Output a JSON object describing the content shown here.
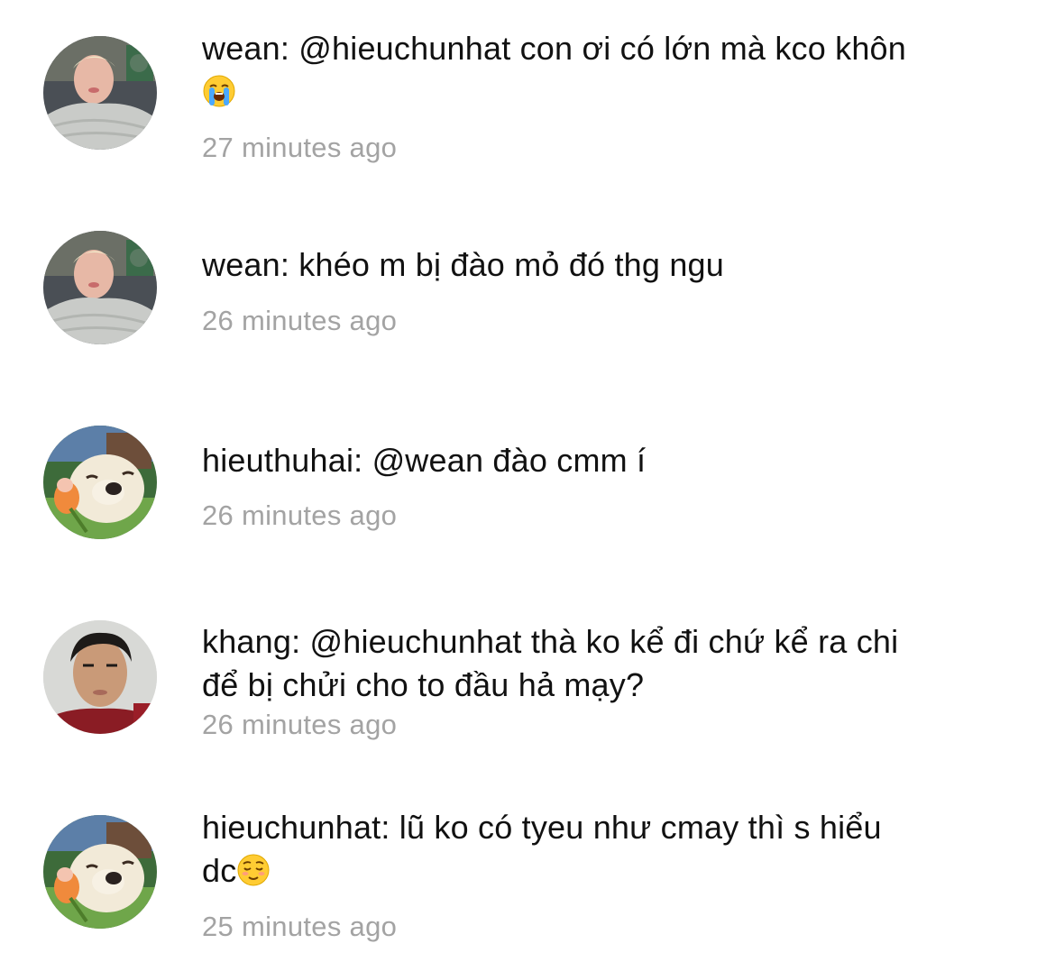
{
  "comments": [
    {
      "avatar": "avatar-blond-person",
      "username": "wean",
      "text": "@hieuchunhat con ơi có lớn mà kco khôn",
      "emoji": "loudly-crying-face-emoji",
      "time": "27 minutes ago"
    },
    {
      "avatar": "avatar-blond-person",
      "username": "wean",
      "text": "khéo m bị đào mỏ đó thg ngu",
      "time": "26 minutes ago"
    },
    {
      "avatar": "avatar-dog-with-flower",
      "username": "hieuthuhai",
      "text": "@wean đào cmm í",
      "time": "26 minutes ago"
    },
    {
      "avatar": "avatar-young-man",
      "username": "khang",
      "text": "@hieuchunhat thà ko kể đi chứ kể ra chi",
      "text_line2": "để bị chửi cho to đầu hả mạy?",
      "time": "26 minutes ago"
    },
    {
      "avatar": "avatar-dog-with-flower",
      "username": "hieuchunhat",
      "text": "lũ ko có tyeu như cmay thì s hiểu",
      "text_line2": "dc",
      "emoji": "relieved-face-emoji",
      "time": "25 minutes ago"
    }
  ]
}
